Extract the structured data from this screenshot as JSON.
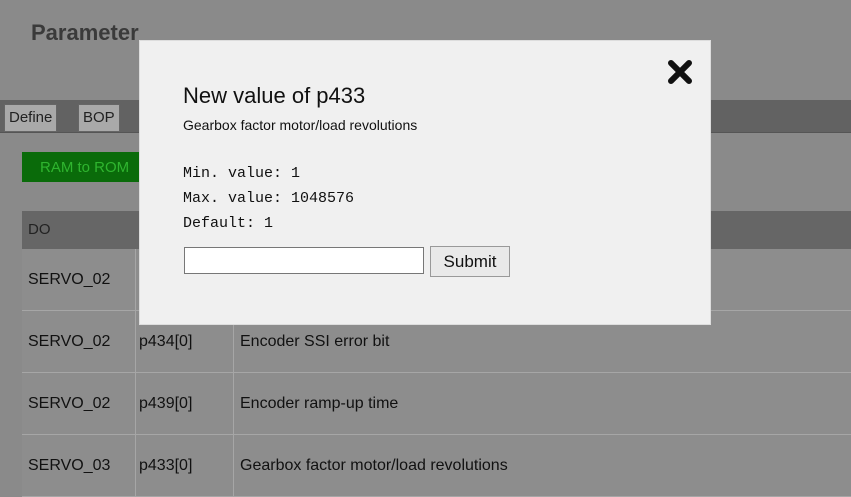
{
  "page": {
    "title": "Parameter"
  },
  "tabs": [
    {
      "label": "Define"
    },
    {
      "label": "BOP"
    }
  ],
  "toolbar": {
    "ram_to_rom_label": "RAM to ROM"
  },
  "table": {
    "header": {
      "do": "DO"
    },
    "rows": [
      {
        "do": "SERVO_02",
        "param": "",
        "description": ""
      },
      {
        "do": "SERVO_02",
        "param": "p434[0]",
        "description": "Encoder SSI error bit"
      },
      {
        "do": "SERVO_02",
        "param": "p439[0]",
        "description": "Encoder ramp-up time"
      },
      {
        "do": "SERVO_03",
        "param": "p433[0]",
        "description": "Gearbox factor motor/load revolutions"
      }
    ]
  },
  "dialog": {
    "title": "New value of p433",
    "subtitle": "Gearbox factor motor/load revolutions",
    "min_text": "Min. value: 1",
    "max_text": "Max. value: 1048576",
    "default_text": "Default: 1",
    "input_value": "",
    "submit_label": "Submit",
    "close_icon": "close-x-icon"
  }
}
